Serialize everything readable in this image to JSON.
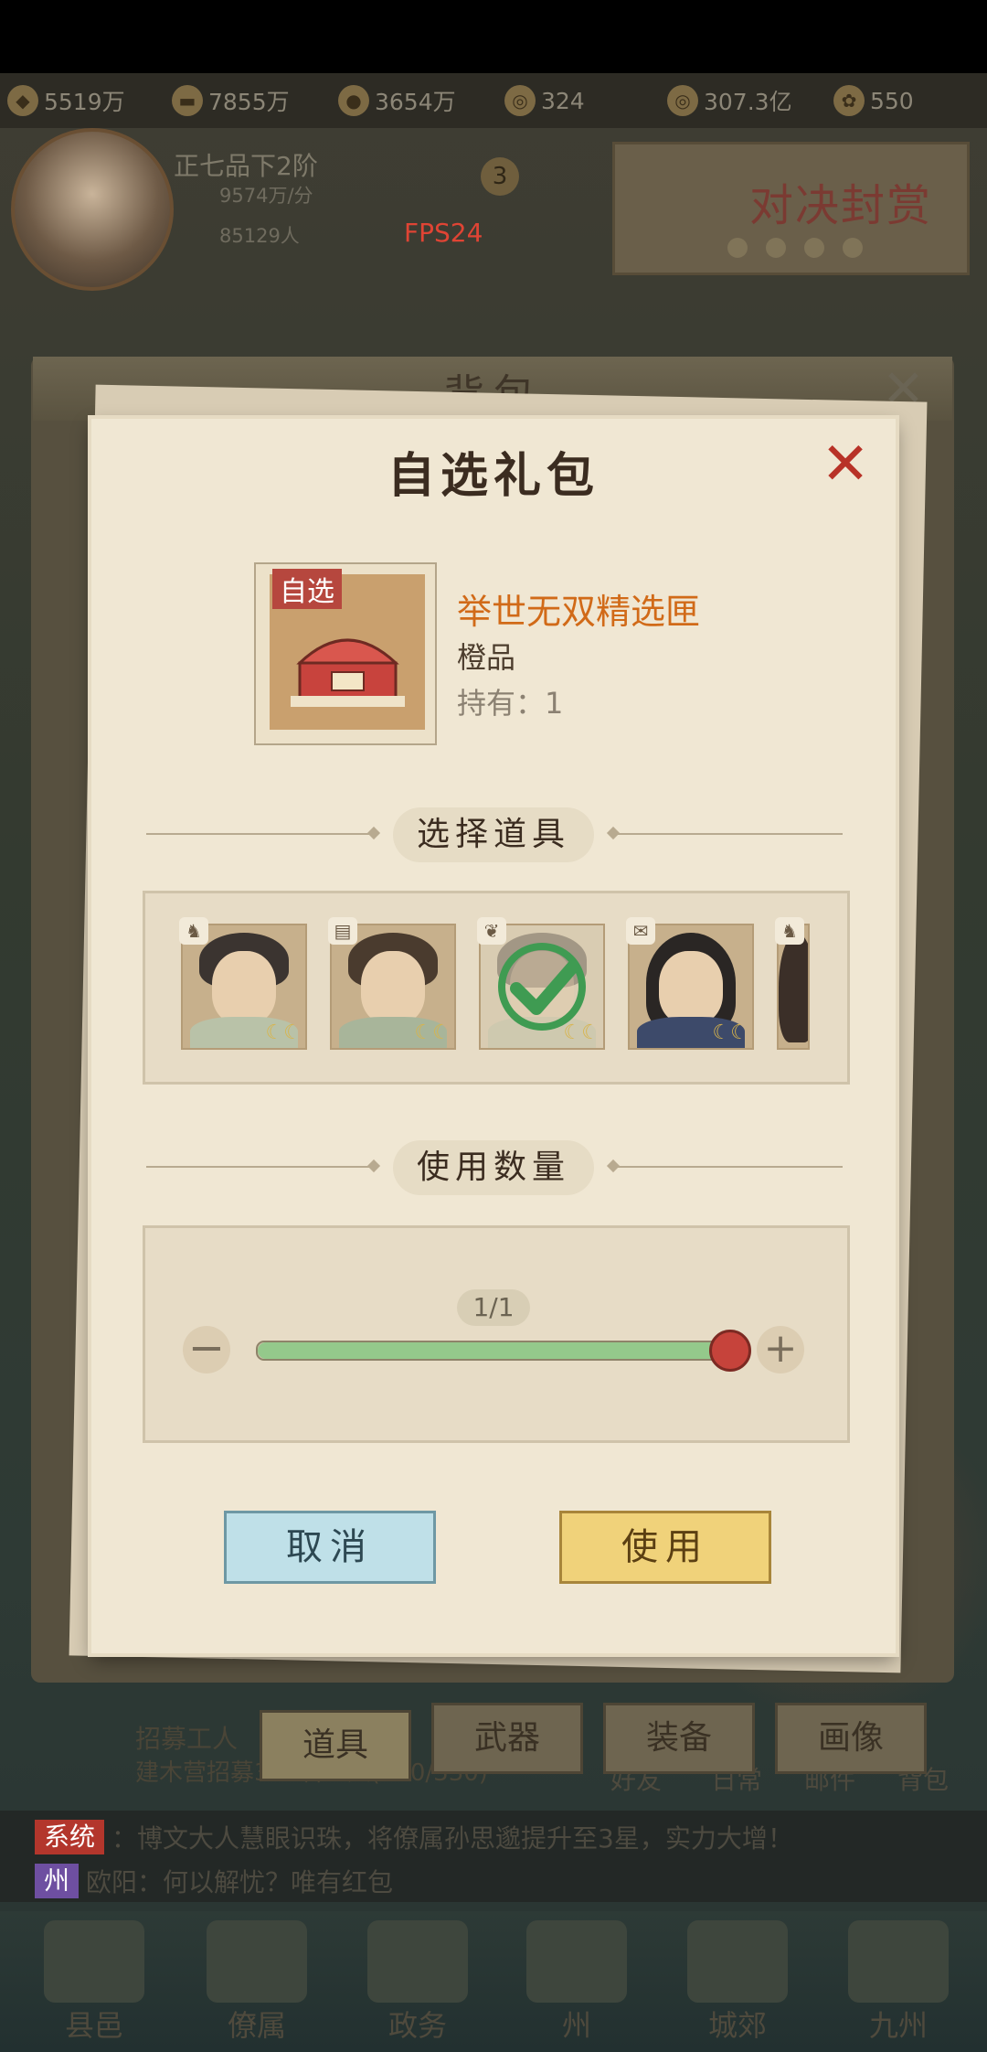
{
  "resources": [
    {
      "icon": "gold-coins-icon",
      "value": "5519万"
    },
    {
      "icon": "timber-icon",
      "value": "7855万"
    },
    {
      "icon": "grain-icon",
      "value": "3654万"
    },
    {
      "icon": "copper-coin-icon",
      "value": "324"
    },
    {
      "icon": "coin-icon",
      "value": "307.3亿"
    },
    {
      "icon": "flower-icon",
      "value": "550"
    }
  ],
  "player": {
    "rank": "正七品下2阶",
    "income": "9574万/分",
    "population": "85129人",
    "level": "3"
  },
  "fps": "FPS24",
  "banner": {
    "text": "对决封赏"
  },
  "bag": {
    "title": "背包",
    "close": "✕",
    "tabs": [
      {
        "label": "道具",
        "active": true
      },
      {
        "label": "武器",
        "active": false
      },
      {
        "label": "装备",
        "active": false
      },
      {
        "label": "画像",
        "active": false
      }
    ]
  },
  "task": {
    "title": "招募工人",
    "progress_line": "建木营招募330名工人(250/330)"
  },
  "side_labels": [
    "好友",
    "日常",
    "邮件",
    "背包"
  ],
  "chat": [
    {
      "tag": "系统",
      "tag_color": "#b3362c",
      "text": "：博文大人慧眼识珠，将僚属孙思邈提升至3星，实力大增！"
    },
    {
      "tag": "州",
      "tag_color": "#6e4fa1",
      "text": "欧阳：何以解忧？唯有红包"
    }
  ],
  "nav": [
    "县邑",
    "僚属",
    "政务",
    "州",
    "城郊",
    "九州"
  ],
  "dialog": {
    "title": "自选礼包",
    "close": "✕",
    "item": {
      "badge": "自选",
      "name": "举世无双精选匣",
      "grade": "橙品",
      "holding": "持有：1",
      "name_color": "#d16a18"
    },
    "select_heading": "选择道具",
    "heroes": [
      {
        "class_icon": "horse-icon",
        "selected": false
      },
      {
        "class_icon": "book-icon",
        "selected": false
      },
      {
        "class_icon": "fan-icon",
        "selected": true
      },
      {
        "class_icon": "scroll-icon",
        "selected": false
      },
      {
        "class_icon": "horse-icon",
        "selected": false
      }
    ],
    "quantity_heading": "使用数量",
    "quantity": {
      "label": "1/1",
      "current": 1,
      "max": 1,
      "minus": "−",
      "plus": "+"
    },
    "cancel_label": "取消",
    "use_label": "使用"
  }
}
